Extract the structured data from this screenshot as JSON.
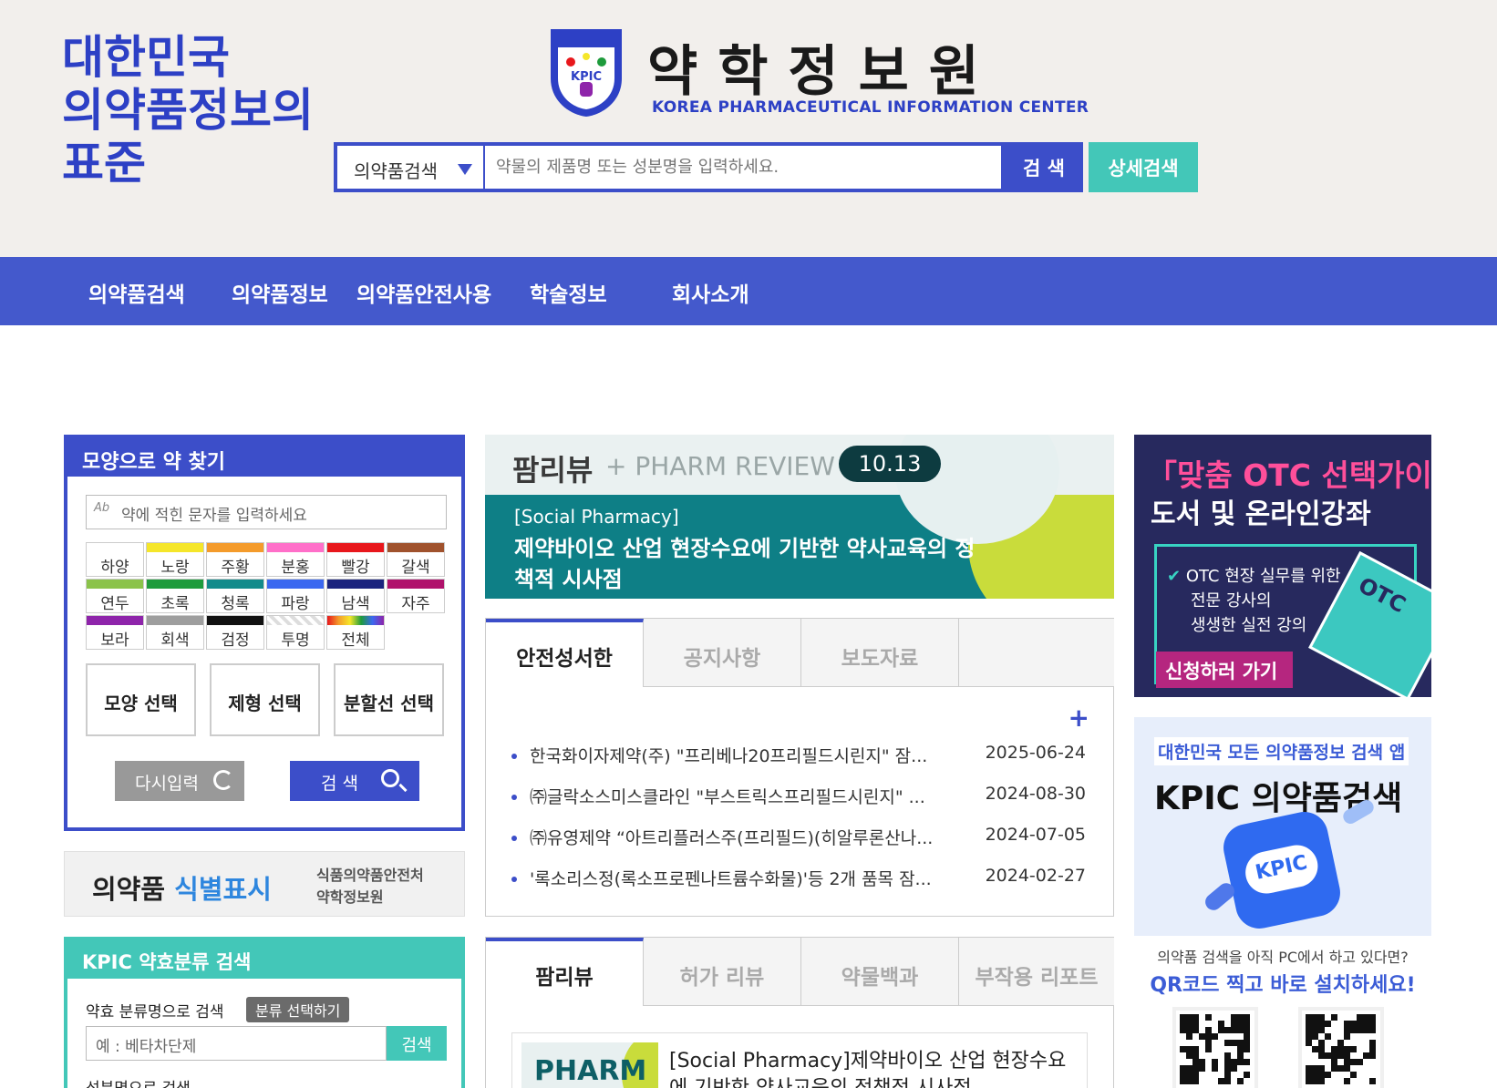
{
  "header": {
    "slogan": [
      "대한민국",
      "의약품정보의",
      "표준"
    ],
    "logo_title": "약학정보원",
    "logo_subtitle": "KOREA PHARMACEUTICAL INFORMATION CENTER",
    "logo_emblem_text": "KPIC"
  },
  "search": {
    "select_value": "의약품검색",
    "placeholder": "약물의 제품명 또는 성분명을 입력하세요.",
    "search_label": "검 색",
    "advanced_label": "상세검색"
  },
  "nav": {
    "items": [
      "의약품검색",
      "의약품정보",
      "의약품안전사용",
      "학술정보",
      "회사소개"
    ]
  },
  "shape_search": {
    "title": "모양으로 약 찾기",
    "mark_placeholder": "약에 적힌 문자를 입력하세요",
    "colors": [
      {
        "label": "하양",
        "color": "#ffffff"
      },
      {
        "label": "노랑",
        "color": "#f5e62a"
      },
      {
        "label": "주황",
        "color": "#f49b2b"
      },
      {
        "label": "분홍",
        "color": "#ff6fc9"
      },
      {
        "label": "빨강",
        "color": "#e8171c"
      },
      {
        "label": "갈색",
        "color": "#a0522d"
      },
      {
        "label": "연두",
        "color": "#8bc34a"
      },
      {
        "label": "초록",
        "color": "#1e9b3c"
      },
      {
        "label": "청록",
        "color": "#138b8b"
      },
      {
        "label": "파랑",
        "color": "#3b68f0"
      },
      {
        "label": "남색",
        "color": "#1a237e"
      },
      {
        "label": "자주",
        "color": "#b0116b"
      },
      {
        "label": "보라",
        "color": "#8e24aa"
      },
      {
        "label": "회색",
        "color": "#9e9e9e"
      },
      {
        "label": "검정",
        "color": "#111111"
      },
      {
        "label": "투명",
        "color": "#dddddd"
      },
      {
        "label": "전체",
        "color": "rainbow"
      }
    ],
    "buttons": [
      "모양 선택",
      "제형 선택",
      "분할선 선택"
    ],
    "reset_label": "다시입력",
    "find_label": "검 색"
  },
  "id_banner": {
    "label_a": "의약품",
    "label_b": "식별표시",
    "org_line1": "식품의약품안전처",
    "org_line2": "약학정보원"
  },
  "kpic_search": {
    "title": "KPIC 약효분류 검색",
    "class_label": "약효 분류명으로 검색",
    "class_pill": "분류 선택하기",
    "class_placeholder": "예 : 베타차단제",
    "class_button": "검색",
    "ingredient_label": "성분명으로 검색"
  },
  "pharm_banner": {
    "title": "팜리뷰",
    "subtitle": "+ PHARM REVIEW",
    "date": "10.13",
    "category": "[Social Pharmacy]",
    "headline": "제약바이오 산업 현장수요에 기반한 약사교육의 정책적 시사점"
  },
  "notice_tabs": {
    "tabs": [
      "안전성서한",
      "공지사항",
      "보도자료"
    ],
    "more": "+",
    "items": [
      {
        "title": "한국화이자제약(주) \"프리베나20프리필드시린지\" 잠...",
        "date": "2025-06-24"
      },
      {
        "title": "㈜글락소스미스클라인 \"부스트릭스프리필드시린지\" ...",
        "date": "2024-08-30"
      },
      {
        "title": "㈜유영제약 “아트리플러스주(프리필드)(히알루론산나...",
        "date": "2024-07-05"
      },
      {
        "title": "'록소리스정(록소프로펜나트륨수화물)'등 2개 품목 잠...",
        "date": "2024-02-27"
      }
    ]
  },
  "review_tabs": {
    "tabs": [
      "팜리뷰",
      "허가 리뷰",
      "약물백과",
      "부작용 리포트"
    ],
    "item_thumb": "PHARM",
    "item_title": "[Social Pharmacy]제약바이오 산업 현장수요에 기반한 약사교육의 정책적 시사점"
  },
  "otc_banner": {
    "title1": "「맞춤 OTC 선택가이드」",
    "title2": "도서 및 온라인강좌",
    "check": "✔",
    "desc": [
      "OTC 현장 실무를 위한",
      "전문 강사의",
      "생생한 실전 강의"
    ],
    "cta": "신청하러 가기",
    "book_text": "OTC"
  },
  "app_banner": {
    "top": "대한민국 모든 의약품정보 검색 앱",
    "name": "KPIC 의약품검색",
    "icon_text": "KPIC",
    "question": "의약품 검색을 아직 PC에서 하고 있다면?",
    "cta": "QR코드 찍고 바로 설치하세요!"
  }
}
